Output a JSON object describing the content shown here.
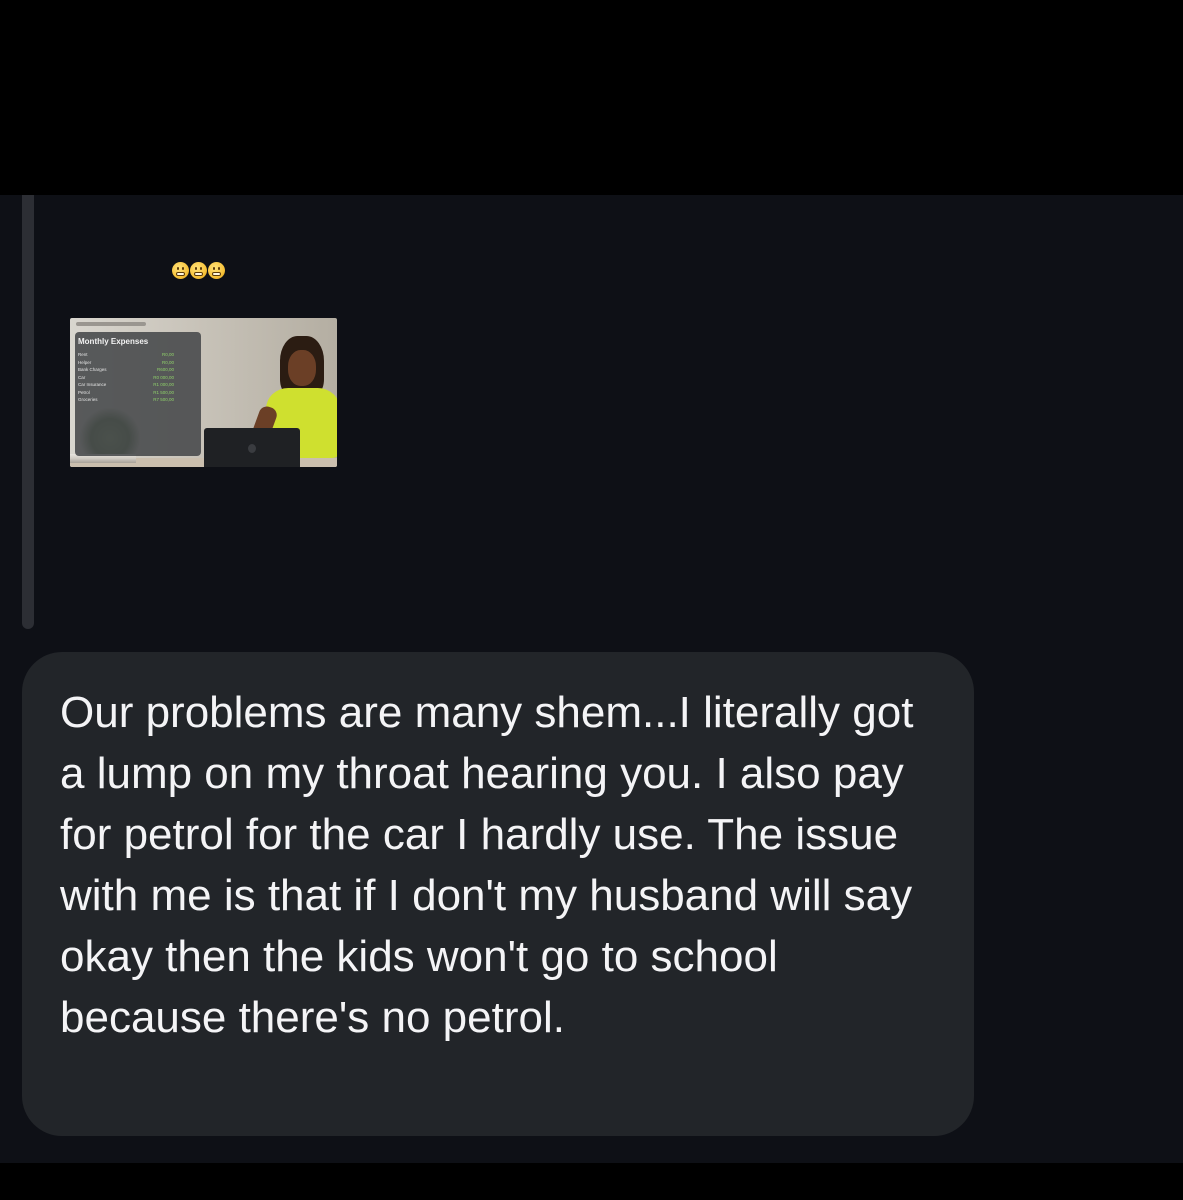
{
  "reply": {
    "emojis": [
      "grimacing-face-emoji",
      "grimacing-face-emoji",
      "grimacing-face-emoji"
    ],
    "thumbnail": {
      "title": "Monthly Expenses",
      "rows": [
        {
          "label": "Rent",
          "value": "R0,00"
        },
        {
          "label": "Helper",
          "value": "R0,00"
        },
        {
          "label": "Bank Charges",
          "value": "R600,00"
        },
        {
          "label": "Car",
          "value": "R0 000,00"
        },
        {
          "label": "Car Insurance",
          "value": "R1 000,00"
        },
        {
          "label": "Petrol",
          "value": "R1 500,00"
        },
        {
          "label": "Groceries",
          "value": "R7 500,00"
        }
      ]
    }
  },
  "message": {
    "text": "Our problems are many shem...I literally got a lump on my throat hearing you. I also pay for petrol for the car I hardly use. The issue with me is that if I don't my husband will say okay then the kids won't go to school because there's no petrol."
  },
  "colors": {
    "background": "#0e1016",
    "bubble": "#222529",
    "text": "#f4f4f6",
    "reply_bar": "#2c2e34"
  }
}
